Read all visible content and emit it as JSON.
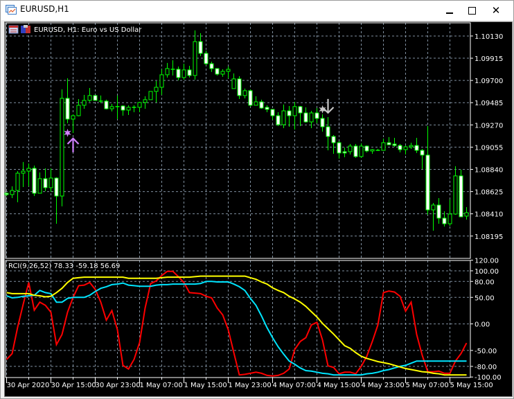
{
  "window": {
    "title": "EURUSD,H1",
    "minimize_icon": "minimize-icon",
    "maximize_icon": "maximize-icon",
    "close_icon": "close-icon"
  },
  "chart_header": {
    "symbol_label": "EURUSD, H1:  Euro vs US Dollar"
  },
  "indicator": {
    "label": "RCI(9,26,52) 78.33 -59.18 56.69"
  },
  "colors": {
    "background": "#000000",
    "candle": "#00ff00",
    "bear_body": "#ffffff",
    "grid": "#8090a0",
    "rci_short": "#ff0000",
    "rci_mid": "#00e5ff",
    "rci_long": "#ffff00",
    "buy_signal": "#d080ff",
    "sell_signal": "#c8c8c8"
  },
  "chart_data": [
    {
      "type": "candlestick",
      "title": "EURUSD, H1:  Euro vs US Dollar",
      "point": 1e-05,
      "ylim": [
        1.07979,
        1.10257
      ],
      "price_ticks": [
        "1.10130",
        "1.09915",
        "1.09700",
        "1.09485",
        "1.09270",
        "1.09055",
        "1.08840",
        "1.08625",
        "1.08410",
        "1.08195"
      ],
      "time_ticks": [
        "30 Apr 2020",
        "30 Apr 15:00",
        "30 Apr 23:00",
        "1 May 07:00",
        "1 May 15:00",
        "1 May 23:00",
        "4 May 07:00",
        "4 May 15:00",
        "4 May 23:00",
        "5 May 07:00",
        "5 May 15:00"
      ],
      "time_tick_every_bars": 8,
      "grid": true,
      "ohlc_points": [
        [
          108609,
          108616,
          108582,
          108596
        ],
        [
          108596,
          108676,
          108562,
          108636
        ],
        [
          108636,
          108823,
          108522,
          108803
        ],
        [
          108803,
          108911,
          108669,
          108823
        ],
        [
          108823,
          108897,
          108676,
          108850
        ],
        [
          108850,
          108877,
          108582,
          108609
        ],
        [
          108609,
          108810,
          108609,
          108750
        ],
        [
          108750,
          108850,
          108629,
          108663
        ],
        [
          108663,
          108850,
          108622,
          108756
        ],
        [
          108756,
          108763,
          108314,
          108582
        ],
        [
          108582,
          109614,
          108482,
          109527
        ],
        [
          109527,
          109721,
          109286,
          109326
        ],
        [
          109326,
          109373,
          109192,
          109359
        ],
        [
          109359,
          109520,
          109353,
          109460
        ],
        [
          109460,
          109560,
          109426,
          109507
        ],
        [
          109507,
          109627,
          109493,
          109554
        ],
        [
          109554,
          109554,
          109507,
          109507
        ],
        [
          109500,
          109554,
          109480,
          109500
        ],
        [
          109500,
          109514,
          109420,
          109426
        ],
        [
          109426,
          109473,
          109400,
          109447
        ],
        [
          109447,
          109554,
          109326,
          109447
        ],
        [
          109453,
          109460,
          109359,
          109413
        ],
        [
          109413,
          109460,
          109366,
          109440
        ],
        [
          109440,
          109460,
          109393,
          109440
        ],
        [
          109440,
          109493,
          109393,
          109487
        ],
        [
          109487,
          109547,
          109426,
          109514
        ],
        [
          109514,
          109594,
          109514,
          109594
        ],
        [
          109594,
          109694,
          109487,
          109634
        ],
        [
          109634,
          109808,
          109560,
          109755
        ],
        [
          109755,
          109869,
          109728,
          109815
        ],
        [
          109808,
          109895,
          109748,
          109808
        ],
        [
          109808,
          109835,
          109701,
          109728
        ],
        [
          109728,
          109862,
          109708,
          109802
        ],
        [
          109802,
          109842,
          109728,
          109748
        ],
        [
          109748,
          110184,
          109708,
          110076
        ],
        [
          110076,
          110157,
          109936,
          109962
        ],
        [
          109962,
          109989,
          109849,
          109862
        ],
        [
          109862,
          109882,
          109782,
          109815
        ],
        [
          109815,
          109815,
          109748,
          109761
        ],
        [
          109761,
          109808,
          109735,
          109788
        ],
        [
          109788,
          109835,
          109721,
          109808
        ],
        [
          109621,
          109768,
          109621,
          109715
        ],
        [
          109715,
          109741,
          109520,
          109554
        ],
        [
          109554,
          109621,
          109527,
          109601
        ],
        [
          109601,
          109614,
          109447,
          109460
        ],
        [
          109460,
          109547,
          109460,
          109493
        ],
        [
          109493,
          109514,
          109426,
          109433
        ],
        [
          109440,
          109460,
          109393,
          109420
        ],
        [
          109420,
          109420,
          109319,
          109359
        ],
        [
          109359,
          109393,
          109259,
          109272
        ],
        [
          109272,
          109467,
          109239,
          109406
        ],
        [
          109406,
          109453,
          109252,
          109359
        ],
        [
          109359,
          109493,
          109225,
          109447
        ],
        [
          109447,
          109453,
          109259,
          109386
        ],
        [
          109386,
          109440,
          109292,
          109299
        ],
        [
          109299,
          109406,
          109239,
          109386
        ],
        [
          109386,
          109433,
          109286,
          109333
        ],
        [
          109333,
          109373,
          109205,
          109252
        ],
        [
          109252,
          109346,
          109024,
          109158
        ],
        [
          109158,
          109172,
          108991,
          109098
        ],
        [
          109098,
          109112,
          108944,
          108998
        ],
        [
          109011,
          109051,
          108957,
          108998
        ],
        [
          109011,
          109085,
          108984,
          109065
        ],
        [
          109065,
          109085,
          108951,
          108964
        ],
        [
          108964,
          109091,
          108951,
          109065
        ],
        [
          109065,
          109071,
          109004,
          109018
        ],
        [
          109018,
          109038,
          108991,
          109031
        ],
        [
          109024,
          109038,
          109018,
          109024
        ],
        [
          109024,
          109138,
          109024,
          109098
        ],
        [
          109098,
          109152,
          109078,
          109078
        ],
        [
          109085,
          109145,
          109058,
          109071
        ],
        [
          109071,
          109085,
          109004,
          109031
        ],
        [
          109031,
          109071,
          108984,
          109058
        ],
        [
          109058,
          109098,
          109038,
          109071
        ],
        [
          109071,
          109145,
          108998,
          109024
        ],
        [
          109024,
          109038,
          108844,
          108978
        ],
        [
          108978,
          109259,
          108401,
          108448
        ],
        [
          108448,
          108515,
          108247,
          108495
        ],
        [
          108495,
          108562,
          108314,
          108368
        ],
        [
          108368,
          108435,
          108287,
          108314
        ],
        [
          108314,
          108549,
          108294,
          108408
        ],
        [
          108408,
          108870,
          108401,
          108777
        ],
        [
          108777,
          108837,
          108381,
          108381
        ],
        [
          108388,
          108475,
          108354,
          108421
        ]
      ],
      "signals": [
        {
          "bar": 11,
          "price": 1.09193,
          "type": "star",
          "color": "#d080ff"
        },
        {
          "bar": 12,
          "price": 1.09139,
          "type": "arrow-up",
          "color": "#d080ff"
        },
        {
          "bar": 57,
          "price": 1.0942,
          "type": "star",
          "color": "#c8c8c8"
        },
        {
          "bar": 58,
          "price": 1.09387,
          "type": "arrow-down",
          "color": "#c8c8c8"
        }
      ]
    },
    {
      "type": "line",
      "title": "RCI(9,26,52) 78.33 -59.18 56.69",
      "ylim": [
        -101,
        119.5
      ],
      "y_ticks": [
        "120.00",
        "100.00",
        "80.00",
        "50.00",
        "0.00",
        "-50.00",
        "-80.00",
        "-100.00"
      ],
      "y_tick_values": [
        120,
        100,
        80,
        50,
        0,
        -50,
        -80,
        -100
      ],
      "grid_levels": [
        100,
        80,
        50,
        0,
        -50,
        -80
      ],
      "series": [
        {
          "name": "RCI 9",
          "color": "#ff0000",
          "values": [
            -67,
            -56,
            -6,
            37,
            78,
            26,
            41,
            35,
            22,
            -39,
            -20,
            22,
            50,
            72,
            73,
            78,
            65,
            41,
            7,
            25,
            -11,
            -78,
            -85,
            -67,
            -35,
            30,
            76,
            81,
            91,
            99,
            99,
            89,
            78,
            59,
            58,
            57,
            52,
            49,
            30,
            17,
            -11,
            -54,
            -96,
            -95,
            -93,
            -91,
            -93,
            -97,
            -98,
            -97,
            -93,
            -85,
            -48,
            -33,
            -26,
            -2,
            3,
            -30,
            -79,
            -82,
            -94,
            -91,
            -91,
            -94,
            -80,
            -61,
            -33,
            -2,
            59,
            62,
            60,
            52,
            24,
            41,
            -20,
            -59,
            -90,
            -90,
            -89,
            -93,
            -93,
            -70,
            -56,
            -36
          ]
        },
        {
          "name": "RCI 26",
          "color": "#00e5ff",
          "values": [
            53,
            49,
            50,
            52,
            53,
            54,
            63,
            59,
            57,
            41,
            41,
            48,
            50,
            50,
            50,
            54,
            61,
            67,
            70,
            74,
            75,
            77,
            73,
            72,
            71,
            71,
            71,
            73,
            74,
            74,
            75,
            75,
            75,
            75,
            75,
            76,
            80,
            80,
            79,
            79,
            79,
            75,
            70,
            63,
            48,
            35,
            15,
            -7,
            -26,
            -43,
            -57,
            -70,
            -76,
            -83,
            -88,
            -89,
            -91,
            -93,
            -94,
            -96,
            -96,
            -96,
            -96,
            -96,
            -96,
            -94,
            -93,
            -91,
            -88,
            -86,
            -83,
            -80,
            -78,
            -74,
            -70,
            -70,
            -70,
            -70,
            -70,
            -70,
            -70,
            -70,
            -70,
            -70
          ]
        },
        {
          "name": "RCI 52",
          "color": "#ffff00",
          "values": [
            59,
            57,
            57,
            57,
            57,
            54,
            53,
            51,
            52,
            59,
            67,
            78,
            86,
            87,
            88,
            88,
            88,
            88,
            88,
            88,
            88,
            88,
            86,
            86,
            86,
            86,
            86,
            86,
            87,
            88,
            88,
            88,
            88,
            88,
            89,
            90,
            90,
            90,
            90,
            90,
            90,
            90,
            90,
            90,
            87,
            84,
            79,
            75,
            68,
            63,
            59,
            52,
            47,
            41,
            33,
            23,
            13,
            1,
            -9,
            -19,
            -30,
            -41,
            -46,
            -54,
            -61,
            -65,
            -68,
            -71,
            -73,
            -75,
            -78,
            -81,
            -84,
            -86,
            -88,
            -90,
            -91,
            -93,
            -94,
            -96,
            -96,
            -96,
            -96,
            -96
          ]
        }
      ]
    }
  ]
}
